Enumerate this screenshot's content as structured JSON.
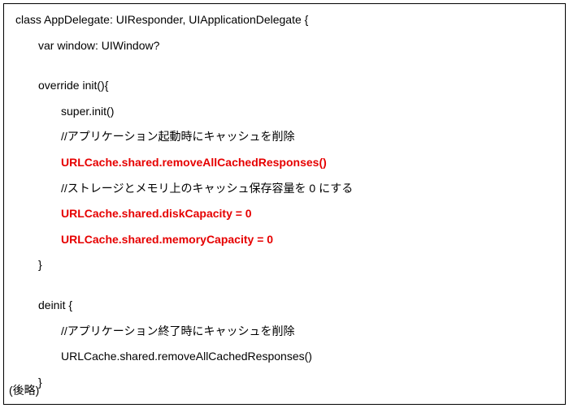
{
  "code": {
    "l1": "class AppDelegate: UIResponder, UIApplicationDelegate {",
    "l2": "var window: UIWindow?",
    "l3": "override init(){",
    "l4": "super.init()",
    "l5": "//アプリケーション起動時にキャッシュを削除",
    "l6": "URLCache.shared.removeAllCachedResponses()",
    "l7": "//ストレージとメモリ上のキャッシュ保存容量を 0 にする",
    "l8": "URLCache.shared.diskCapacity = 0",
    "l9": "URLCache.shared.memoryCapacity = 0",
    "l10": "}",
    "l11": "deinit {",
    "l12": "//アプリケーション終了時にキャッシュを削除",
    "l13": "URLCache.shared.removeAllCachedResponses()",
    "l14": "}",
    "footer": "(後略)"
  }
}
